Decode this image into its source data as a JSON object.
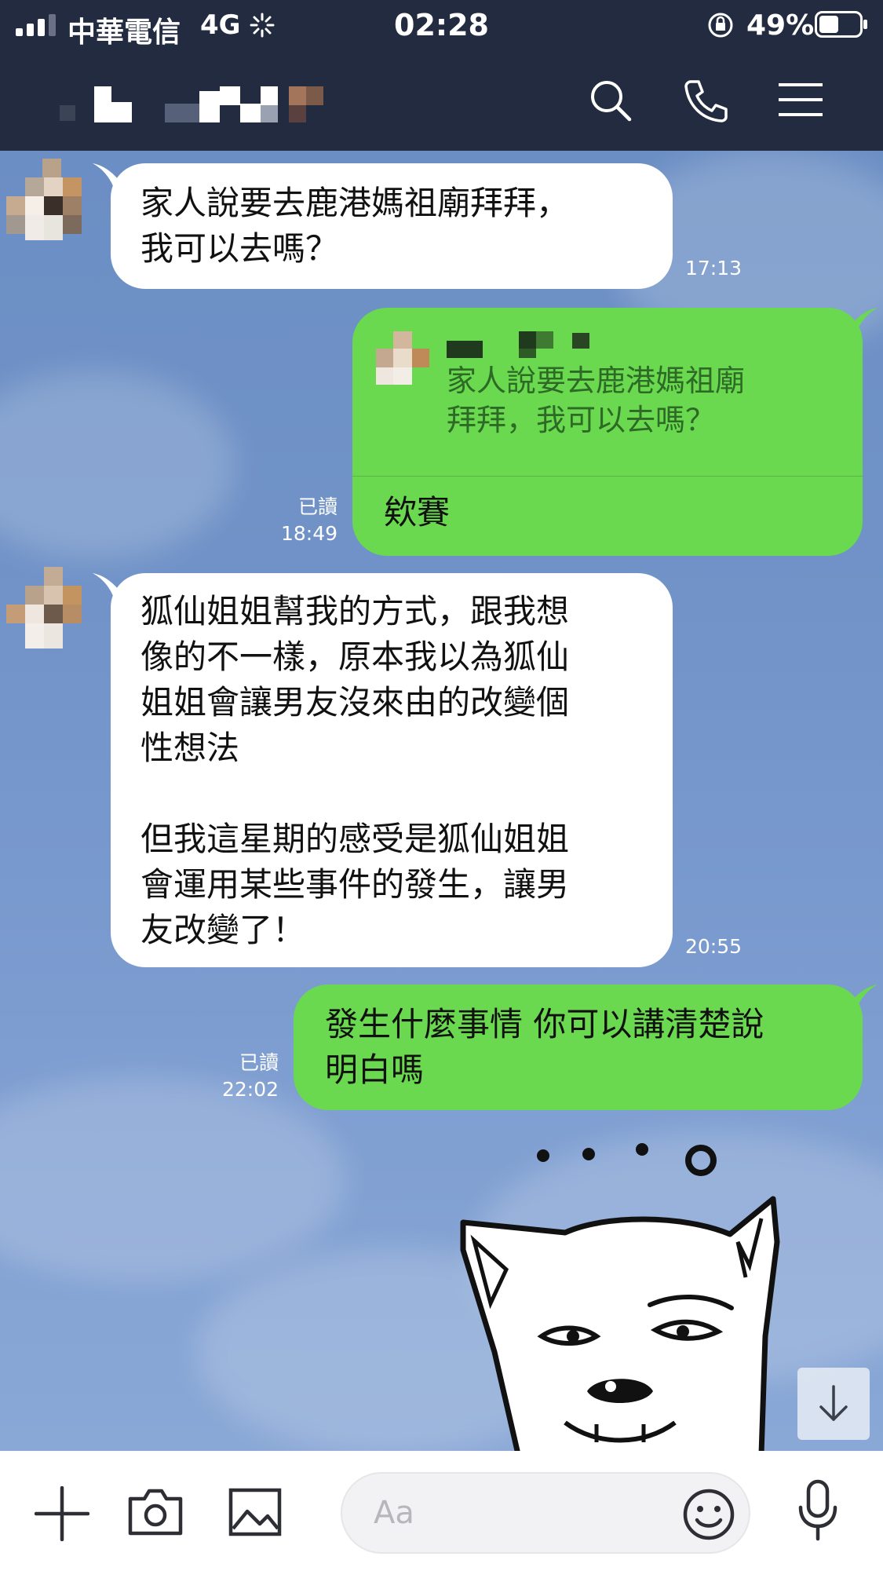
{
  "status_bar": {
    "carrier": "中華電信",
    "network": "4G",
    "time": "02:28",
    "battery": "49%",
    "battery_level": 0.49
  },
  "header": {
    "contact_name_hidden": true,
    "icons": [
      "search-icon",
      "phone-icon",
      "menu-icon"
    ]
  },
  "messages": [
    {
      "direction": "in",
      "text": "家人說要去鹿港媽祖廟拜拜，\n我可以去嗎？",
      "time": "17:13"
    },
    {
      "direction": "out",
      "reply_quote": "家人說要去鹿港媽祖廟\n拜拜，我可以去嗎？",
      "text": "欸賽",
      "read": "已讀",
      "time": "18:49"
    },
    {
      "direction": "in",
      "text": "狐仙姐姐幫我的方式，跟我想\n像的不一樣，原本我以為狐仙\n姐姐會讓男友沒來由的改變個\n性想法\n\n但我這星期的感受是狐仙姐姐\n會運用某些事件的發生，讓男\n友改變了！",
      "time": "20:55"
    },
    {
      "direction": "out",
      "text": "發生什麼事情 你可以講清楚說\n明白嗎",
      "read": "已讀",
      "time": "22:02"
    }
  ],
  "sticker": {
    "name": "dog-sticker",
    "dots": "• • •"
  },
  "input_bar": {
    "placeholder": "Aa",
    "icons": [
      "plus-icon",
      "camera-icon",
      "image-icon",
      "emoji-icon",
      "microphone-icon"
    ]
  },
  "colors": {
    "header_bg": "#222b3f",
    "outgoing_bubble": "#6ad950",
    "incoming_bubble": "#ffffff",
    "chat_bg": "#7193c8"
  }
}
